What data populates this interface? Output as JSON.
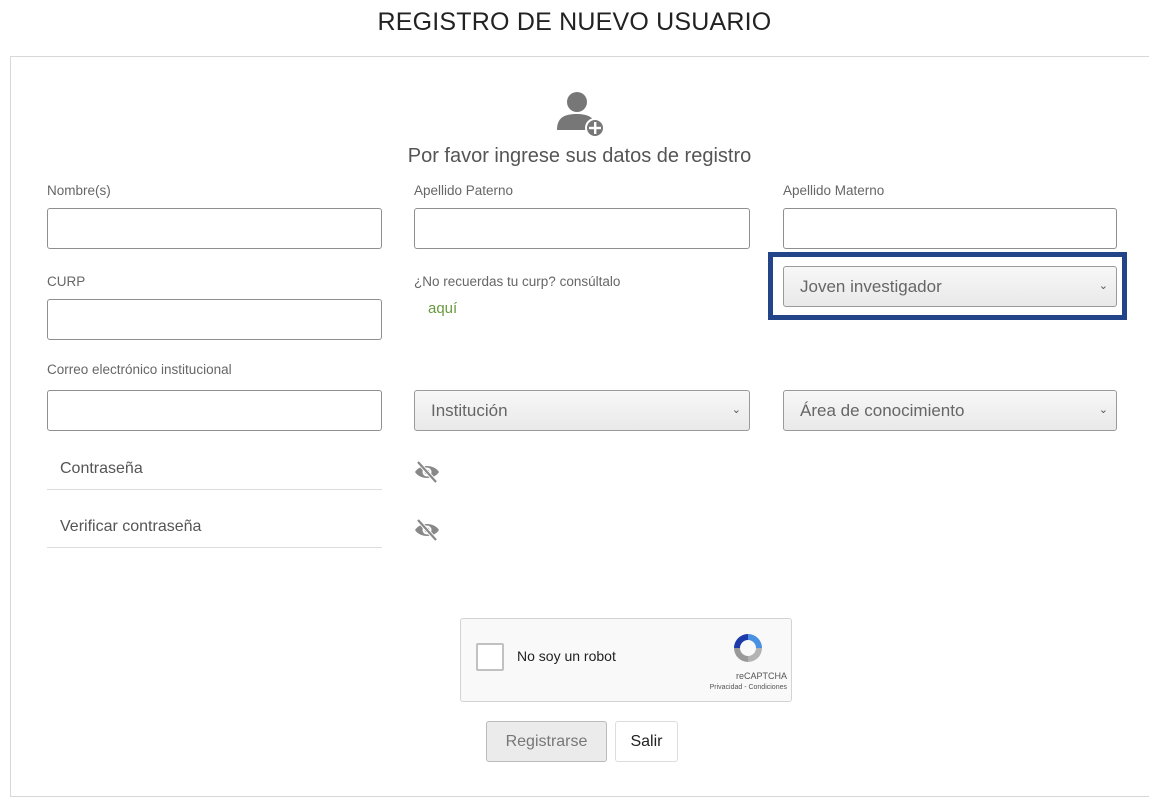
{
  "page": {
    "title": "REGISTRO DE NUEVO USUARIO",
    "subtitle": "Por favor ingrese sus datos de registro"
  },
  "form": {
    "nombre": {
      "label": "Nombre(s)",
      "value": ""
    },
    "apellido_paterno": {
      "label": "Apellido Paterno",
      "value": ""
    },
    "apellido_materno": {
      "label": "Apellido Materno",
      "value": ""
    },
    "curp": {
      "label": "CURP",
      "value": ""
    },
    "curp_help": {
      "text": "¿No recuerdas tu curp? consúltalo",
      "link": "aquí"
    },
    "tipo_usuario": {
      "selected": "Joven investigador"
    },
    "correo": {
      "label": "Correo electrónico institucional",
      "value": ""
    },
    "institucion": {
      "selected": "Institución"
    },
    "area": {
      "selected": "Área de conocimiento"
    },
    "password": {
      "placeholder": "Contraseña"
    },
    "password_confirm": {
      "placeholder": "Verificar contraseña"
    }
  },
  "captcha": {
    "label": "No soy un robot",
    "brand": "reCAPTCHA",
    "terms": "Privacidad - Condiciones"
  },
  "buttons": {
    "register": "Registrarse",
    "exit": "Salir"
  },
  "icons": {
    "avatar": "add-user-icon",
    "password_eye": "eye-slash-icon",
    "password_confirm_eye": "eye-slash-icon",
    "select_chevron": "chevron-down-icon",
    "captcha": "recaptcha-logo-icon"
  },
  "colors": {
    "highlight_border": "#24448a",
    "link": "#6a9a40",
    "avatar": "#777777"
  }
}
